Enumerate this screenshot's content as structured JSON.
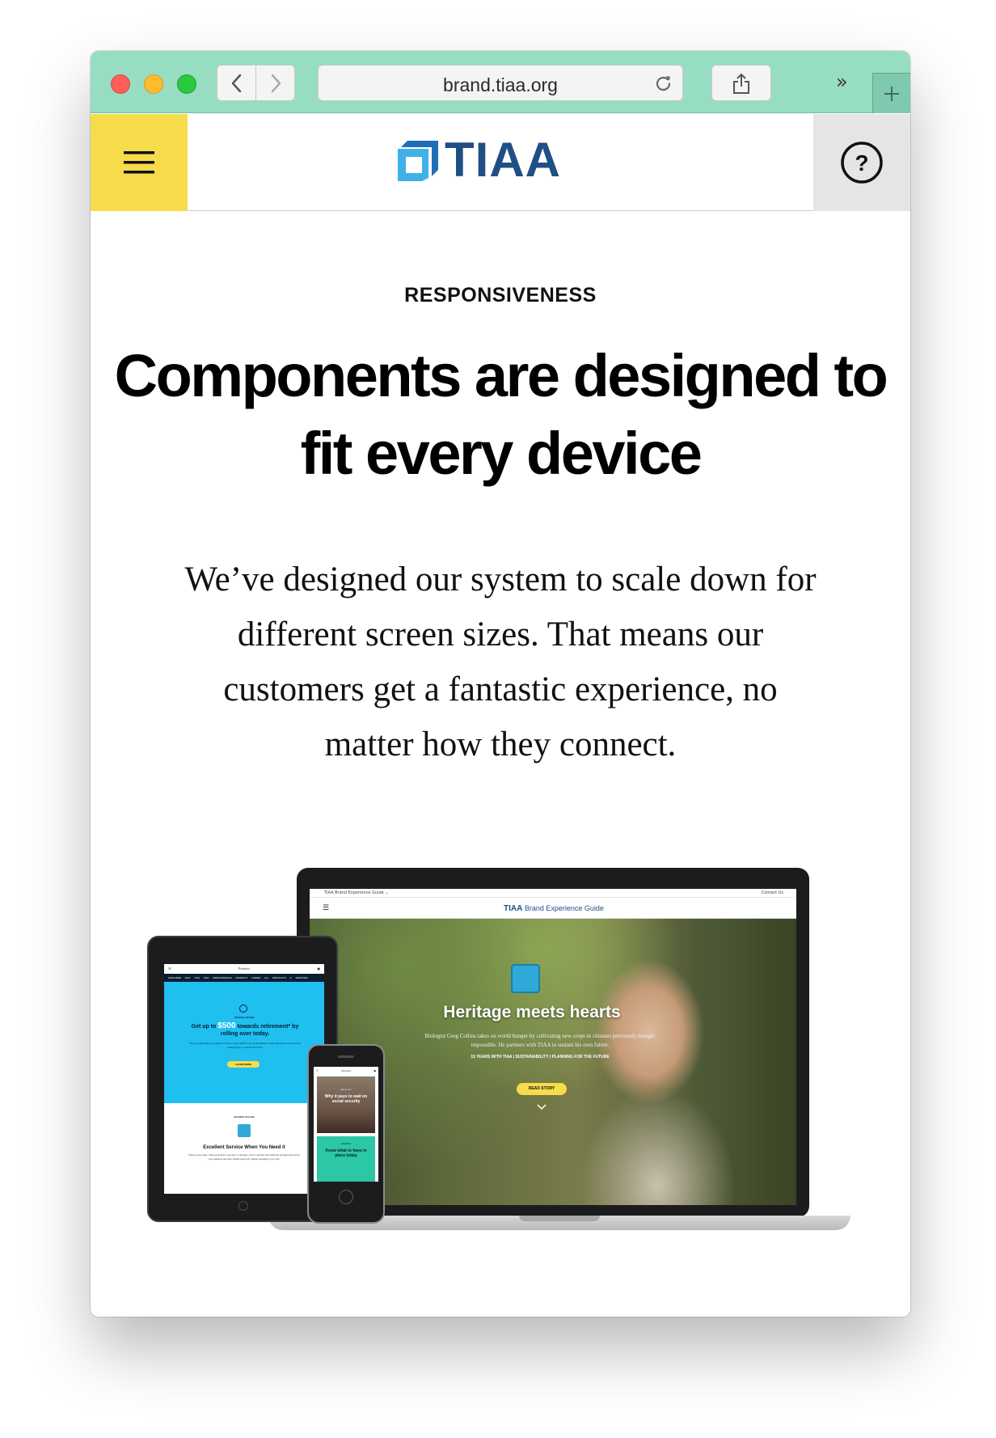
{
  "browser": {
    "address": "brand.tiaa.org",
    "colors": {
      "toolbar": "#97ddc2"
    }
  },
  "header": {
    "logo_text": "TIAA",
    "colors": {
      "menu_bg": "#f6dc4a",
      "help_bg": "#e5e5e5",
      "brand": "#1f4f84"
    },
    "icons": {
      "menu": "hamburger-menu-icon",
      "help": "question-mark-icon",
      "logo": "tiaa-logo-mark"
    }
  },
  "content": {
    "eyebrow": "RESPONSIVENESS",
    "headline": "Components are designed to fit every device",
    "body": "We’ve designed our system to scale down for different screen sizes. That means our customers get a fantastic experience, no matter how they connect."
  },
  "devices": {
    "laptop": {
      "topbar_left": "TIAA Brand Experience Guide ⌄",
      "topbar_right": "Contact Us",
      "brand": "TIAA",
      "brand_sub": "Brand Experience Guide",
      "hero_title": "Heritage meets hearts",
      "hero_text": "Biologist Greg Collins takes on world hunger by cultivating new crops in climates previously thought impossible. He partners with TIAA to sustain his own future.",
      "hero_meta": "15 YEARS WITH TIAA | SUSTAINABILITY | PLANNING FOR THE FUTURE",
      "hero_cta": "READ STORY"
    },
    "tablet": {
      "title": "Products",
      "nav": "FEATURED  WHY TIAA  OUR PERFORMANCE  PRODUCT FINDER  ALL PRODUCTS & SERVICES",
      "special": "SPECIAL OFFER",
      "offer_pre": "Get up to ",
      "offer_amount": "$500",
      "offer_post": " towards retirement* by rolling over today.",
      "offer_small": "*Focus on the Future now and get a bonus for up to $500 if you roll retirement accounts with TIAA. Get started by clicking below or call 855-000-0705.",
      "learn": "LEARN MORE",
      "shared": "SHARED VALUES",
      "service": "Excellent Service When You Need it",
      "service_text": "When you become a TIAA participant, you aren’t a customer, you’re a partner. Our dedicated professionals answer your questions and offer reliable approach, without pressuring you to buy."
    },
    "phone": {
      "title": "Education",
      "card1_kicker": "MEET A TOPIC",
      "card1_title": "Why it pays to wait on social security",
      "card2_kicker": "EDUCATION",
      "card2_title": "Know what to have in place today"
    }
  }
}
